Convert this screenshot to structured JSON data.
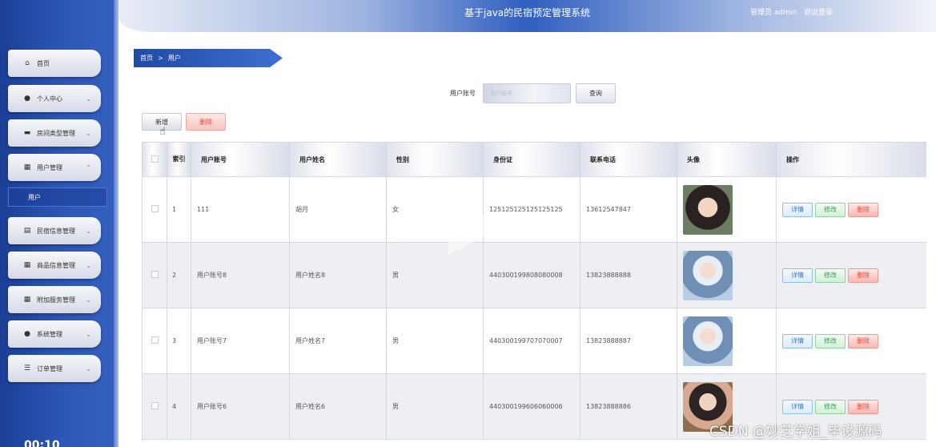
{
  "header": {
    "title": "基于java的民宿预定管理系统",
    "user_text": "管理员 admin",
    "logout": "退出登录"
  },
  "sidebar": {
    "items": [
      {
        "label": "首页",
        "icon": "home-icon"
      },
      {
        "label": "个人中心",
        "icon": "person-icon"
      },
      {
        "label": "房间类型管理",
        "icon": "bed-icon"
      },
      {
        "label": "用户管理",
        "icon": "grid-icon"
      },
      {
        "label": "民宿信息管理",
        "icon": "clipboard-icon"
      },
      {
        "label": "商品信息管理",
        "icon": "grid-icon"
      },
      {
        "label": "附加服务管理",
        "icon": "grid-icon"
      },
      {
        "label": "系统管理",
        "icon": "person-icon"
      },
      {
        "label": "订单管理",
        "icon": "list-icon"
      }
    ],
    "sub_item": "用户",
    "clock_partial": "00:10"
  },
  "breadcrumb": {
    "home": "首页",
    "sep": ">",
    "current": "用户"
  },
  "search": {
    "label": "用户账号",
    "placeholder": "用户账号",
    "button": "查询"
  },
  "actions": {
    "add": "新增",
    "delete": "删除"
  },
  "table": {
    "columns": [
      "",
      "索引",
      "用户账号",
      "用户姓名",
      "性别",
      "身份证",
      "联系电话",
      "头像",
      "操作"
    ],
    "rows": [
      {
        "index": "1",
        "account": "111",
        "name": "胡月",
        "gender": "女",
        "idcard": "125125125125125125",
        "phone": "13612547847",
        "avatar": "avatar-a"
      },
      {
        "index": "2",
        "account": "用户账号8",
        "name": "用户姓名8",
        "gender": "男",
        "idcard": "440300199808080008",
        "phone": "13823888888",
        "avatar": "avatar-b"
      },
      {
        "index": "3",
        "account": "用户账号7",
        "name": "用户姓名7",
        "gender": "男",
        "idcard": "440300199707070007",
        "phone": "13823888887",
        "avatar": "avatar-b"
      },
      {
        "index": "4",
        "account": "用户账号6",
        "name": "用户姓名6",
        "gender": "男",
        "idcard": "440300199606060006",
        "phone": "13823888886",
        "avatar": "avatar-c"
      }
    ],
    "op_labels": {
      "detail": "详情",
      "edit": "修改",
      "delete": "删除"
    }
  },
  "watermark": "CSDN @妙芝学姐_毕设源码"
}
